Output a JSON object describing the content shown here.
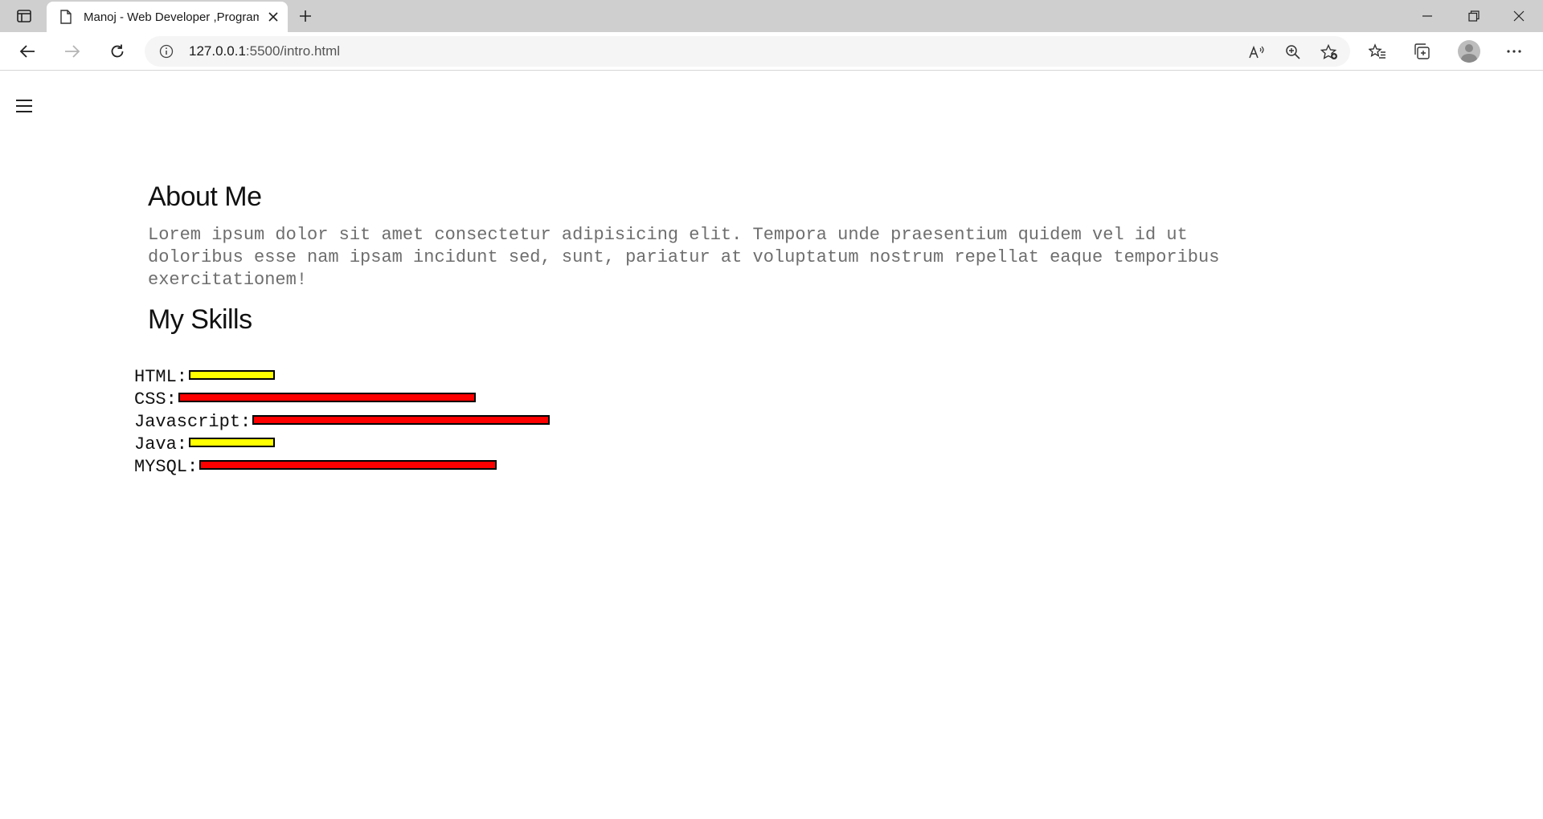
{
  "browser": {
    "tab_title": "Manoj - Web Developer ,Programmer",
    "url_host": "127.0.0.1",
    "url_rest": ":5500/intro.html"
  },
  "page": {
    "about": {
      "heading": "About Me",
      "text": "Lorem ipsum dolor sit amet consectetur adipisicing elit. Tempora unde praesentium quidem vel id ut doloribus esse nam ipsam incidunt sed, sunt, pariatur at voluptatum nostrum repellat eaque temporibus exercitationem!"
    },
    "skills": {
      "heading": "My Skills",
      "items": [
        {
          "label": "HTML:",
          "level": 0.29,
          "color": "#ffff00"
        },
        {
          "label": "CSS:",
          "level": 1.0,
          "color": "#ff0000"
        },
        {
          "label": "Javascript:",
          "level": 1.0,
          "color": "#ff0000"
        },
        {
          "label": "Java:",
          "level": 0.29,
          "color": "#ffff00"
        },
        {
          "label": "MYSQL:",
          "level": 1.0,
          "color": "#ff0000"
        }
      ]
    }
  }
}
